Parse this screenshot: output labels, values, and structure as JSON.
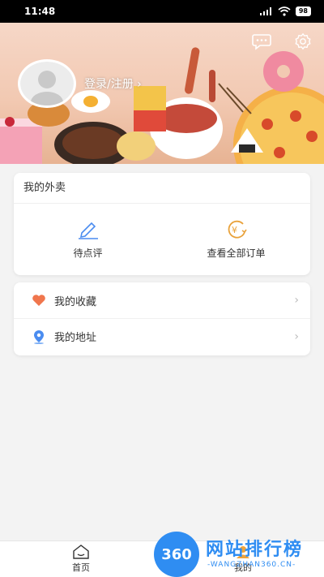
{
  "status": {
    "time": "11:48",
    "battery": "98"
  },
  "profile": {
    "login_text": "登录/注册 ›"
  },
  "orders": {
    "title": "我的外卖",
    "pending_review": "待点评",
    "all_orders": "查看全部订单"
  },
  "menu": [
    {
      "label": "我的收藏",
      "icon": "heart-icon",
      "color": "#f0764d"
    },
    {
      "label": "我的地址",
      "icon": "location-icon",
      "color": "#4a8cf0"
    }
  ],
  "tabs": {
    "home": "首页",
    "mine": "我的"
  },
  "watermark": {
    "logo": "360",
    "title": "网站排行榜",
    "subtitle": "-WANGZHAN360.CN-"
  },
  "colors": {
    "accent": "#4a8cf0",
    "heart": "#f0764d",
    "coin": "#e9a23b"
  }
}
